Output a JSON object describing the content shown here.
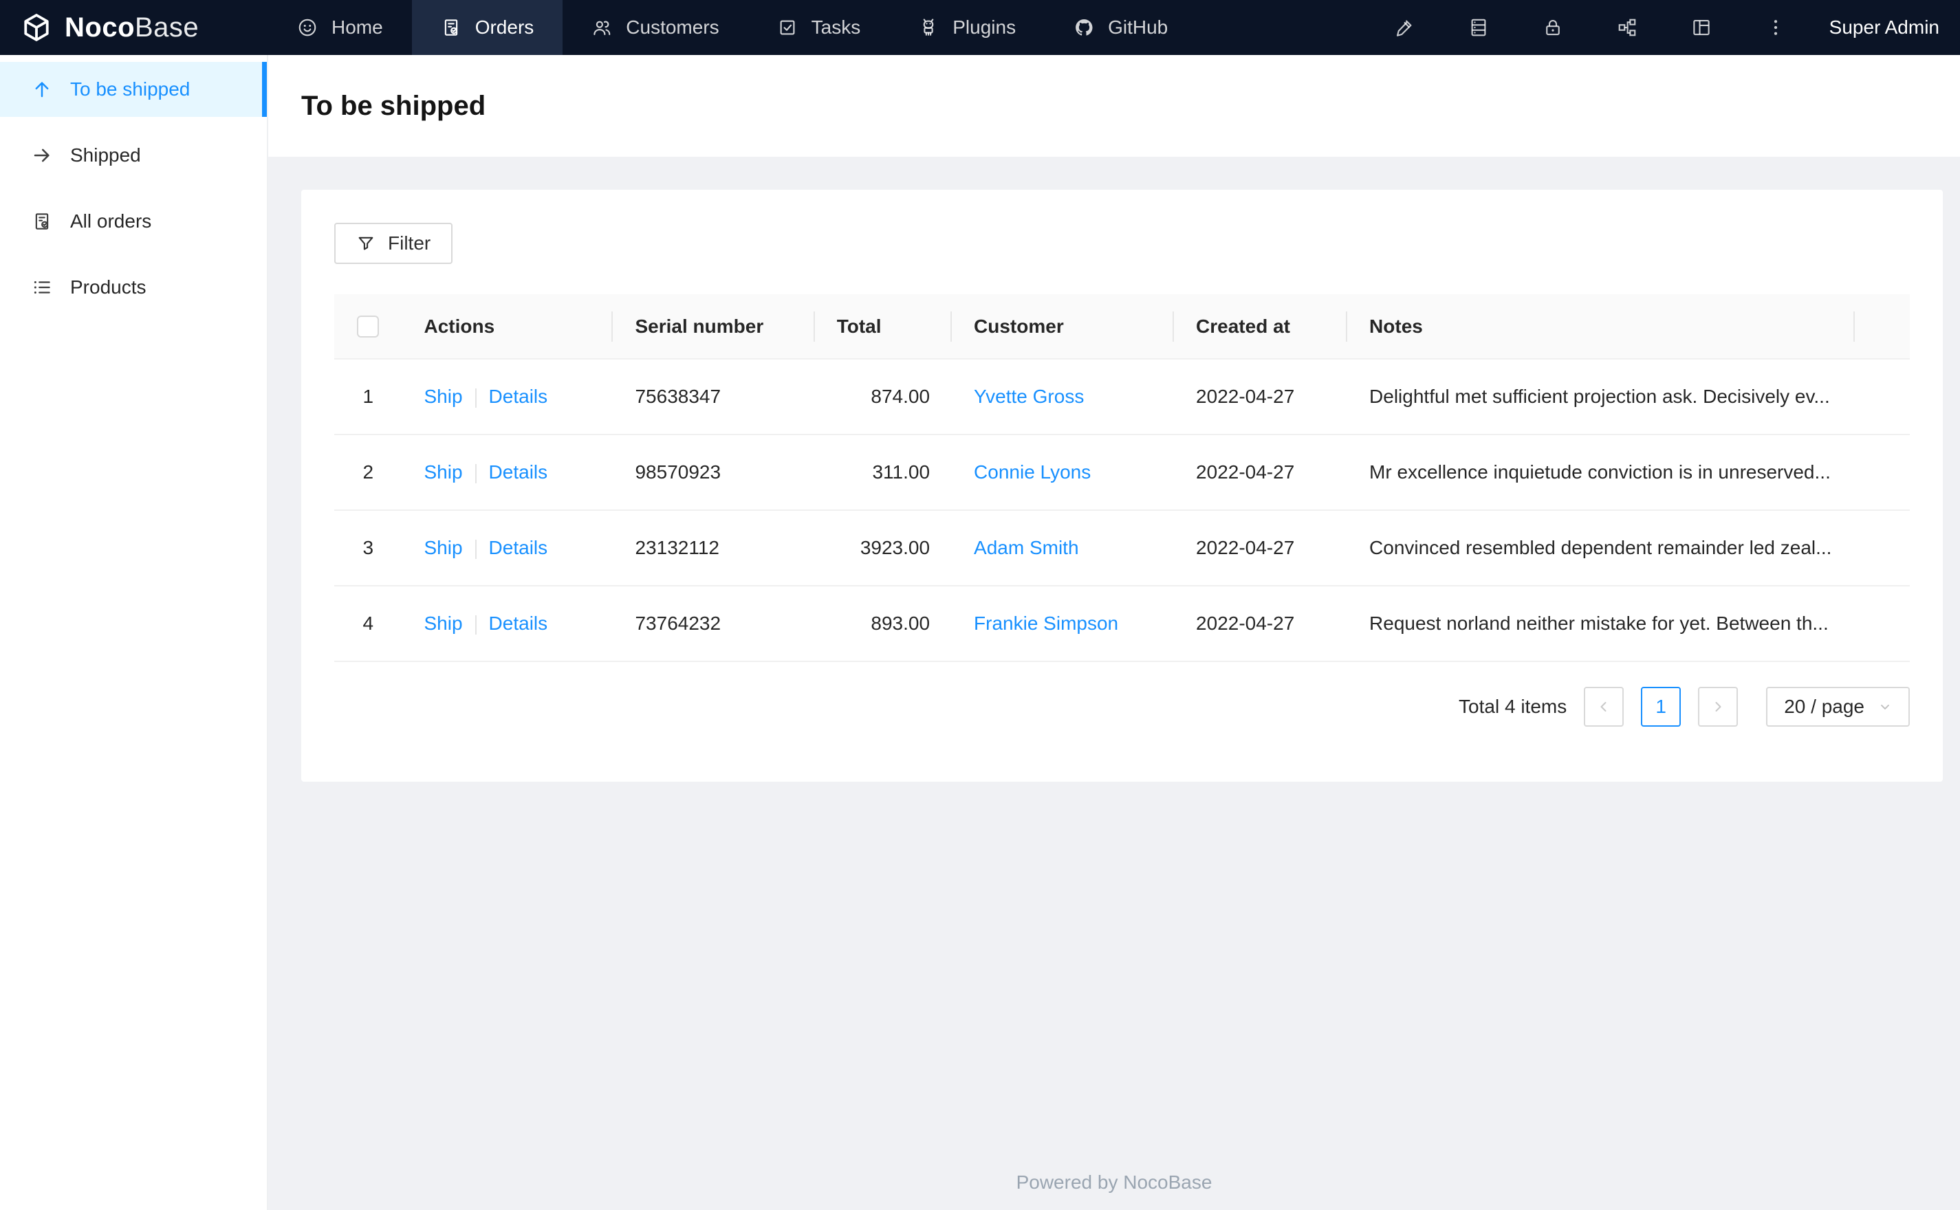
{
  "colors": {
    "accent": "#1890ff",
    "topbar_bg": "#0b1426",
    "topbar_active_bg": "#1e2b43",
    "sidebar_active_bg": "#e6f7ff",
    "content_bg": "#f0f1f4",
    "header_bg": "#fafafa",
    "border": "#f0f0f0"
  },
  "topbar": {
    "brand_bold": "Noco",
    "brand_light": "Base",
    "nav": [
      {
        "label": "Home",
        "icon": "smiley-icon"
      },
      {
        "label": "Orders",
        "icon": "order-file-icon"
      },
      {
        "label": "Customers",
        "icon": "people-icon"
      },
      {
        "label": "Tasks",
        "icon": "check-square-icon"
      },
      {
        "label": "Plugins",
        "icon": "robot-icon"
      },
      {
        "label": "GitHub",
        "icon": "github-icon"
      }
    ],
    "right_icons": [
      "pen-icon",
      "database-icon",
      "lock-icon",
      "org-chart-icon",
      "layout-icon",
      "kebab-menu-icon"
    ],
    "user": "Super Admin"
  },
  "sidebar": {
    "items": [
      {
        "label": "To be shipped",
        "icon": "arrow-up-icon"
      },
      {
        "label": "Shipped",
        "icon": "arrow-right-icon"
      },
      {
        "label": "All orders",
        "icon": "order-file-icon"
      },
      {
        "label": "Products",
        "icon": "list-icon"
      }
    ]
  },
  "page": {
    "title": "To be shipped"
  },
  "toolbar": {
    "filter_label": "Filter"
  },
  "table": {
    "columns": [
      "Actions",
      "Serial number",
      "Total",
      "Customer",
      "Created at",
      "Notes"
    ],
    "rows": [
      {
        "index": "1",
        "ship": "Ship",
        "details": "Details",
        "serial": "75638347",
        "total": "874.00",
        "customer": "Yvette Gross",
        "created_at": "2022-04-27",
        "notes": "Delightful met sufficient projection ask. Decisively ev..."
      },
      {
        "index": "2",
        "ship": "Ship",
        "details": "Details",
        "serial": "98570923",
        "total": "311.00",
        "customer": "Connie Lyons",
        "created_at": "2022-04-27",
        "notes": "Mr excellence inquietude conviction is in unreserved..."
      },
      {
        "index": "3",
        "ship": "Ship",
        "details": "Details",
        "serial": "23132112",
        "total": "3923.00",
        "customer": "Adam Smith",
        "created_at": "2022-04-27",
        "notes": "Convinced resembled dependent remainder led zeal..."
      },
      {
        "index": "4",
        "ship": "Ship",
        "details": "Details",
        "serial": "73764232",
        "total": "893.00",
        "customer": "Frankie Simpson",
        "created_at": "2022-04-27",
        "notes": "Request norland neither mistake for yet. Between th..."
      }
    ]
  },
  "pagination": {
    "total_text": "Total 4 items",
    "current_page": "1",
    "page_size_label": "20 / page"
  },
  "footer": {
    "text": "Powered by NocoBase"
  }
}
